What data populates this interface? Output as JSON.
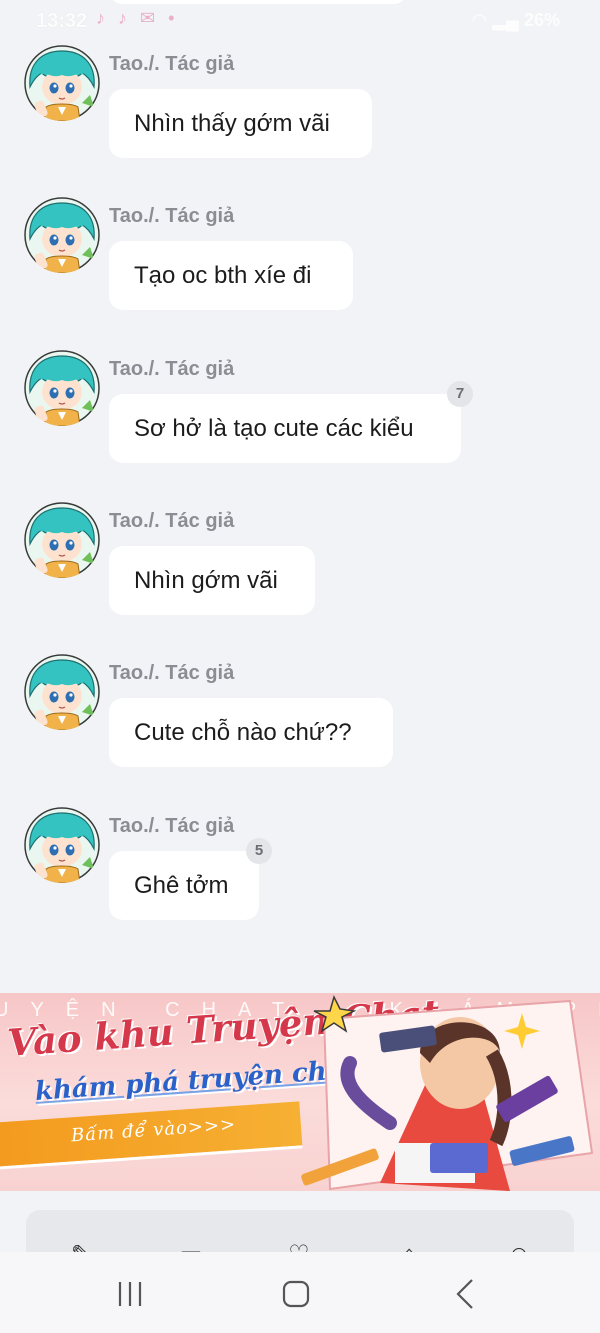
{
  "status_bar": {
    "time": "13:32",
    "battery": "26%"
  },
  "messages": [
    {
      "author": "Tao./. Tác giả",
      "text": "Nhìn thấy gớm vãi",
      "badge": null
    },
    {
      "author": "Tao./. Tác giả",
      "text": "Tạo oc bth xíe đi",
      "badge": null
    },
    {
      "author": "Tao./. Tác giả",
      "text": "Sơ hở là tạo cute các kiểu",
      "badge": "7"
    },
    {
      "author": "Tao./. Tác giả",
      "text": "Nhìn gớm vãi",
      "badge": null
    },
    {
      "author": "Tao./. Tác giả",
      "text": "Cute chỗ nào chứ??",
      "badge": null
    },
    {
      "author": "Tao./. Tác giả",
      "text": "Ghê tởm",
      "badge": "5"
    }
  ],
  "banner": {
    "background_text": "UYỆN CHAT · KHÁM PHÁ",
    "title_line1": "Vào khu Truyện Chat,",
    "title_line2": "khám phá truyện chất",
    "cta": "Bấm để vào>>>"
  },
  "toolbar": {
    "icons": [
      "pen-icon",
      "folder-icon",
      "heart-icon",
      "gift-icon",
      "cat-icon"
    ]
  },
  "nav_bar": {
    "buttons": [
      "recent-apps-icon",
      "home-icon",
      "back-icon"
    ]
  },
  "colors": {
    "background": "#f2f3f6",
    "bubble": "#ffffff",
    "author": "#8a8d93",
    "banner_title_red": "#d6384b",
    "banner_title_blue": "#2b62c9",
    "banner_cta": "#f39a1e"
  }
}
